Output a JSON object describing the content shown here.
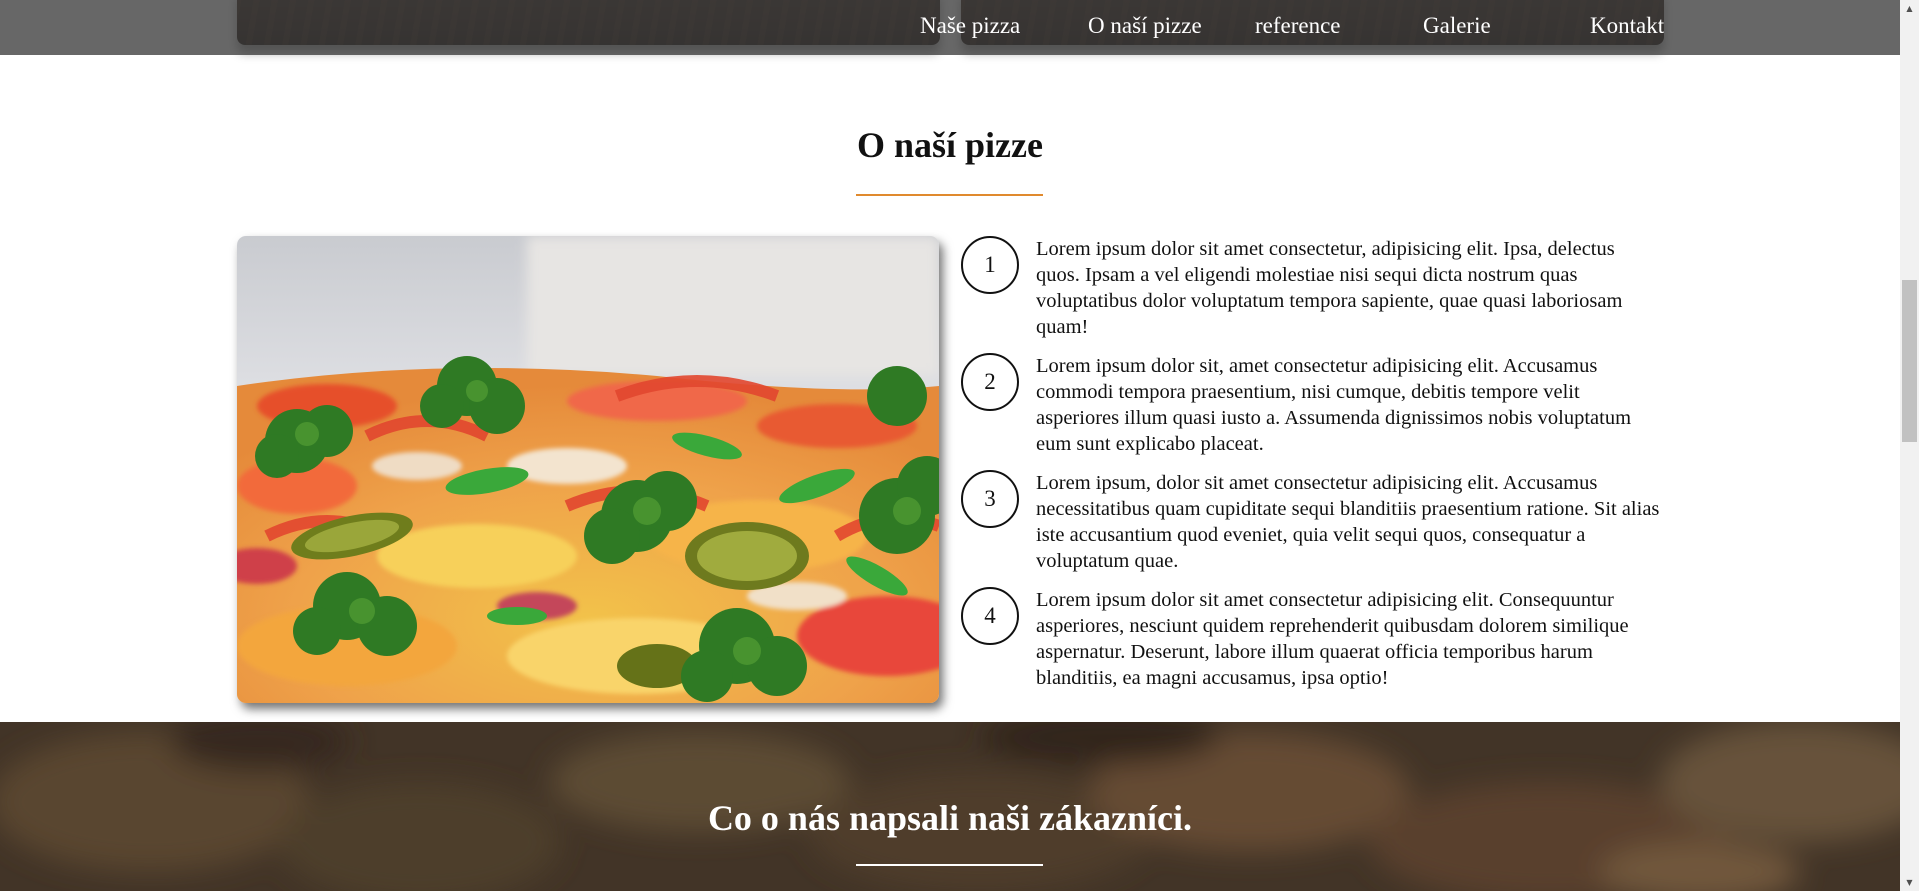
{
  "nav": {
    "items": [
      {
        "label": "Naše pizza"
      },
      {
        "label": "O naší pizze"
      },
      {
        "label": "reference"
      },
      {
        "label": "Galerie"
      },
      {
        "label": "Kontakt"
      }
    ]
  },
  "about": {
    "title": "O naší pizze",
    "accent_color": "#e08a2e",
    "image_icon": "pizza-photo",
    "features": [
      {
        "number": "1",
        "text": "Lorem ipsum dolor sit amet consectetur, adipisicing elit. Ipsa, delectus quos. Ipsam a vel eligendi molestiae nisi sequi dicta nostrum quas voluptatibus dolor voluptatum tempora sapiente, quae quasi laboriosam quam!"
      },
      {
        "number": "2",
        "text": "Lorem ipsum dolor sit, amet consectetur adipisicing elit. Accusamus commodi tempora praesentium, nisi cumque, debitis tempore velit asperiores illum quasi iusto a. Assumenda dignissimos nobis voluptatum eum sunt explicabo placeat."
      },
      {
        "number": "3",
        "text": "Lorem ipsum, dolor sit amet consectetur adipisicing elit. Accusamus necessitatibus quam cupiditate sequi blanditiis praesentium ratione. Sit alias iste accusantium quod eveniet, quia velit sequi quos, consequatur a voluptatum quae."
      },
      {
        "number": "4",
        "text": "Lorem ipsum dolor sit amet consectetur adipisicing elit. Consequuntur asperiores, nesciunt quidem reprehenderit quibusdam dolorem similique aspernatur. Deserunt, labore illum quaerat officia temporibus harum blanditiis, ea magni accusamus, ipsa optio!"
      }
    ]
  },
  "testimonials": {
    "title": "Co o nás napsali naši zákazníci."
  }
}
